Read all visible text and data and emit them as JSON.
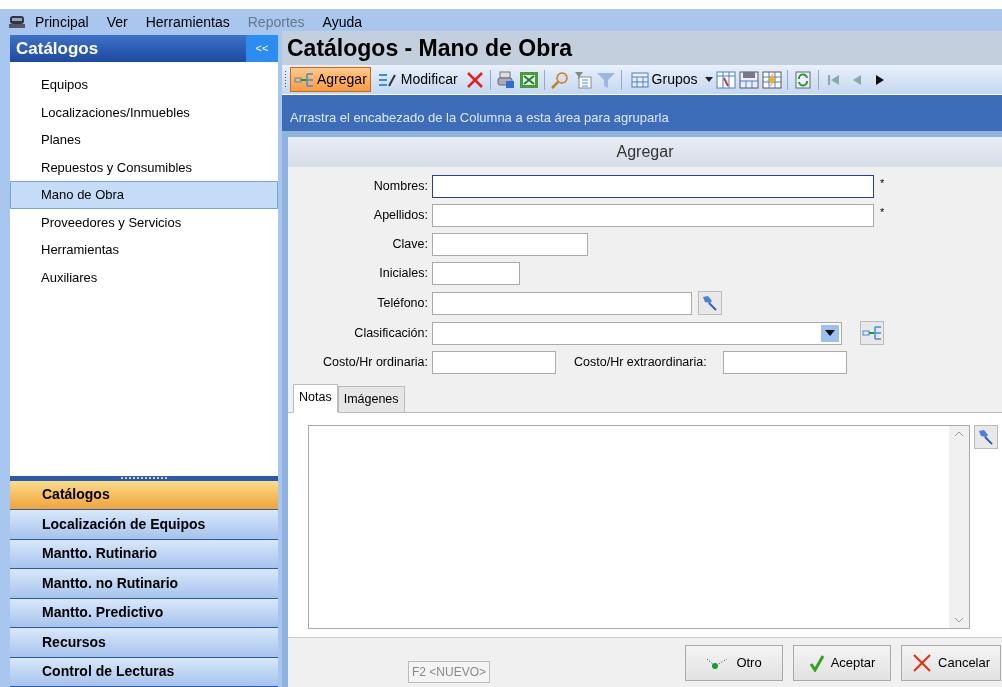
{
  "menu": [
    {
      "label": "Principal",
      "disabled": false
    },
    {
      "label": "Ver",
      "disabled": false
    },
    {
      "label": "Herramientas",
      "disabled": false
    },
    {
      "label": "Reportes",
      "disabled": true
    },
    {
      "label": "Ayuda",
      "disabled": false
    }
  ],
  "sidebar": {
    "title": "Catálogos",
    "collapse": "<<",
    "items": [
      {
        "label": "Equipos",
        "selected": false
      },
      {
        "label": "Localizaciones/Inmuebles",
        "selected": false
      },
      {
        "label": "Planes",
        "selected": false
      },
      {
        "label": "Repuestos y Consumibles",
        "selected": false
      },
      {
        "label": "Mano de Obra",
        "selected": true
      },
      {
        "label": "Proveedores y Servicios",
        "selected": false
      },
      {
        "label": "Herramientas",
        "selected": false
      },
      {
        "label": "Auxiliares",
        "selected": false
      }
    ],
    "sections": [
      {
        "label": "Catálogos",
        "selected": true
      },
      {
        "label": "Localización de Equipos",
        "selected": false
      },
      {
        "label": "Mantto. Rutinario",
        "selected": false
      },
      {
        "label": "Mantto. no Rutinario",
        "selected": false
      },
      {
        "label": "Mantto. Predictivo",
        "selected": false
      },
      {
        "label": "Recursos",
        "selected": false
      },
      {
        "label": "Control de Lecturas",
        "selected": false
      }
    ]
  },
  "page_title": "Catálogos - Mano de Obra",
  "toolbar": [
    {
      "label": "Agregar",
      "selected": true
    },
    {
      "label": "Modificar",
      "selected": false
    },
    {
      "label": "Grupos",
      "selected": false
    }
  ],
  "group_hint": "Arrastra el encabezado de la Columna a esta área para agruparla",
  "form": {
    "title": "Agregar",
    "fields": [
      {
        "label": "Nombres:",
        "kind": "text",
        "focused": true,
        "required": "*"
      },
      {
        "label": "Apellidos:",
        "kind": "text",
        "focused": false,
        "required": "*"
      },
      {
        "label": "Clave:",
        "kind": "text",
        "focused": false
      },
      {
        "label": "Iniciales:",
        "kind": "text",
        "focused": false
      },
      {
        "label": "Teléfono:",
        "kind": "pick",
        "focused": false
      },
      {
        "label": "Clasificación:",
        "kind": "combo",
        "focused": false
      },
      {
        "label": "Costo/Hr ordinaria:",
        "kind": "pair",
        "focused": false,
        "second_label": "Costo/Hr extraordinaria:"
      }
    ],
    "tabs": [
      {
        "label": "Notas",
        "selected": true
      },
      {
        "label": "Imágenes",
        "selected": false
      }
    ],
    "status": "F2 <NUEVO>",
    "buttons": [
      {
        "label": "Otro",
        "kind": "other"
      },
      {
        "label": "Aceptar",
        "kind": "ok"
      },
      {
        "label": "Cancelar",
        "kind": "cancel"
      }
    ]
  }
}
